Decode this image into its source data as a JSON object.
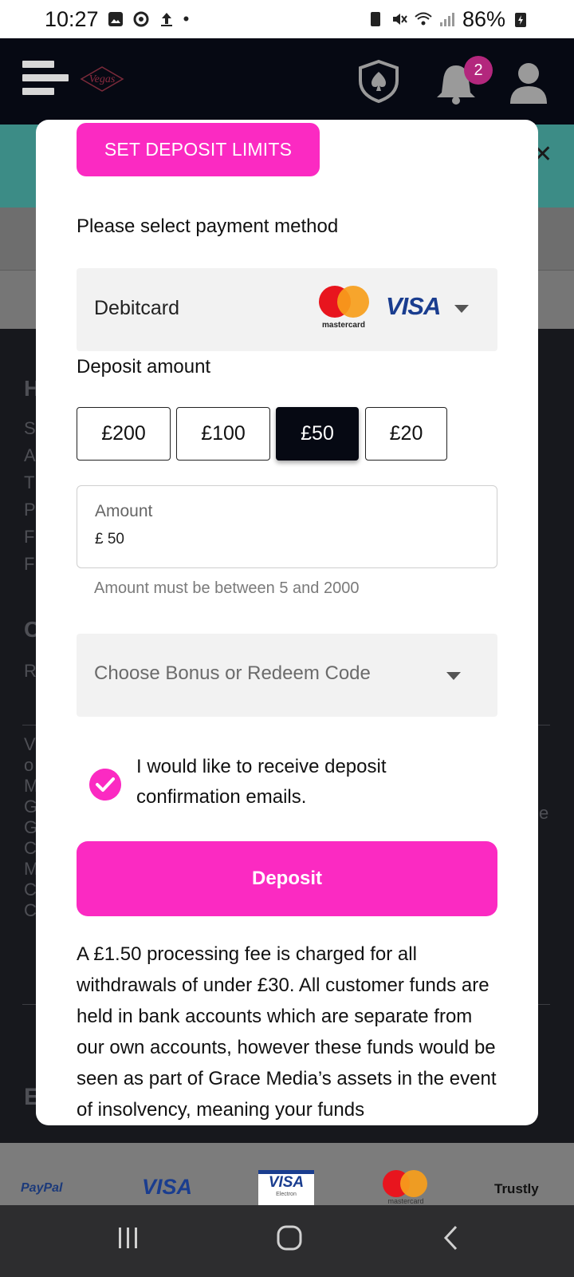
{
  "status_bar": {
    "time": "10:27",
    "battery": "86%"
  },
  "header": {
    "logo_text": "Vegas",
    "notification_count": "2"
  },
  "modal": {
    "set_limits_label": "SET DEPOSIT LIMITS",
    "payment_method_label": "Please select payment method",
    "payment_method_value": "Debitcard",
    "mastercard_text": "mastercard",
    "visa_text": "VISA",
    "deposit_amount_label": "Deposit amount",
    "amount_options": [
      {
        "label": "£200",
        "selected": false
      },
      {
        "label": "£100",
        "selected": false
      },
      {
        "label": "£50",
        "selected": true
      },
      {
        "label": "£20",
        "selected": false
      }
    ],
    "amount_field_label": "Amount",
    "amount_field_value": "£ 50",
    "amount_hint": "Amount must be between 5 and 2000",
    "bonus_placeholder": "Choose Bonus or Redeem Code",
    "email_checkbox_label": "I would like to receive deposit confirmation emails.",
    "email_checkbox_checked": true,
    "deposit_button_label": "Deposit",
    "notice_text": "A £1.50 processing fee is charged for all withdrawals of under £30. All customer funds are held in bank accounts which are separate from our own accounts, however these funds would be seen as part of Grace Media’s assets in the event of insolvency, meaning your funds"
  },
  "footer_payments": {
    "paypal": "PayPal",
    "visa": "VISA",
    "visa_electron": "VISA",
    "electron_sub": "Electron",
    "mastercard": "mastercard",
    "trustly": "Trustly"
  },
  "colors": {
    "accent_pink": "#fb2ac2",
    "header_dark": "#060913",
    "badge": "#b3277d"
  }
}
